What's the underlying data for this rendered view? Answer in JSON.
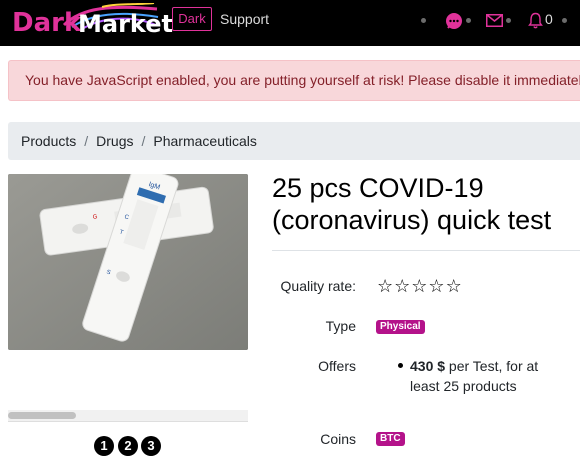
{
  "navbar": {
    "brand_dark": "Dark",
    "brand_market": "Market",
    "theme_toggle": "Dark",
    "support": "Support",
    "notification_count": "0",
    "colors": {
      "background": "#000000",
      "accent": "#e0329a"
    },
    "icons": [
      "chat-icon",
      "mail-icon",
      "bell-icon"
    ]
  },
  "alert": {
    "message": "You have JavaScript enabled, you are putting yourself at risk! Please disable it immediately!"
  },
  "breadcrumb": [
    "Products",
    "Drugs",
    "Pharmaceuticals"
  ],
  "gallery": {
    "pages": [
      "1",
      "2",
      "3"
    ]
  },
  "product": {
    "title": "25 pcs COVID-19 (coronavirus) quick test",
    "quality_label": "Quality rate:",
    "rating": 0,
    "rating_max": 5,
    "type_label": "Type",
    "type_value": "Physical",
    "offers_label": "Offers",
    "offer_amount": "430 $",
    "offer_text": " per Test, for at least 25 products",
    "coins_label": "Coins",
    "coin_value": "BTC"
  }
}
